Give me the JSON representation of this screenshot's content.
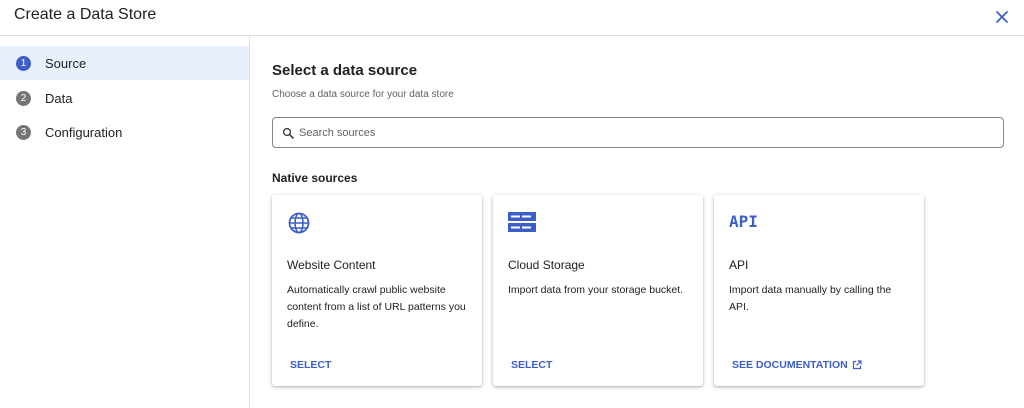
{
  "header": {
    "title": "Create a Data Store"
  },
  "steps": [
    {
      "number": "1",
      "label": "Source"
    },
    {
      "number": "2",
      "label": "Data"
    },
    {
      "number": "3",
      "label": "Configuration"
    }
  ],
  "main": {
    "title": "Select a data source",
    "subtitle": "Choose a data source for your data store",
    "search_placeholder": "Search sources",
    "section_title": "Native sources",
    "cards": [
      {
        "icon": "globe-icon",
        "title": "Website Content",
        "description": "Automatically crawl public website content from a list of URL patterns you define.",
        "action": "SELECT"
      },
      {
        "icon": "storage-icon",
        "title": "Cloud Storage",
        "description": "Import data from your storage bucket.",
        "action": "SELECT"
      },
      {
        "icon": "api-icon",
        "icon_text": "API",
        "title": "API",
        "description": "Import data manually by calling the API.",
        "action": "SEE DOCUMENTATION"
      }
    ]
  },
  "colors": {
    "accent": "#3c5ec9",
    "active_step_bg": "#e8f0fe",
    "inactive_step": "#757575"
  }
}
